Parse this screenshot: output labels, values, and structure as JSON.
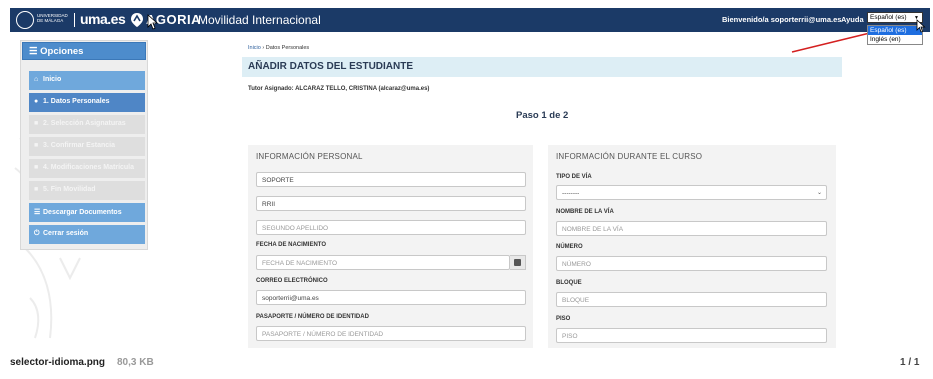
{
  "header": {
    "logo_uma_text": "UNIVERSIDAD\nDE MÁLAGA",
    "logo_umaes": "uma.es",
    "logo_agoria": "AGORIA",
    "app_title": "Movilidad Internacional",
    "welcome": "Bienvenido/a soporterrii@uma.es",
    "help": "Ayuda",
    "lang_selected": "Español (es)",
    "lang_options": [
      "Español (es)",
      "Inglés (en)"
    ],
    "colors": {
      "bar": "#1b3a67",
      "accent": "#4d8ccc",
      "annotation_arrow": "#d42020"
    }
  },
  "sidebar": {
    "title": "Opciones",
    "items": [
      {
        "label": "Inicio",
        "icon": "home-icon",
        "state": "enabled"
      },
      {
        "label": "1. Datos Personales",
        "icon": "user-icon",
        "state": "active"
      },
      {
        "label": "2. Selección Asignaturas",
        "icon": "list-icon",
        "state": "disabled"
      },
      {
        "label": "3. Confirmar Estancia",
        "icon": "list-icon",
        "state": "disabled"
      },
      {
        "label": "4. Modificaciones Matrícula",
        "icon": "list-icon",
        "state": "disabled"
      },
      {
        "label": "5. Fin Movilidad",
        "icon": "list-icon",
        "state": "disabled"
      },
      {
        "label": "Descargar Documentos",
        "icon": "list-icon",
        "state": "enabled"
      },
      {
        "label": "Cerrar sesión",
        "icon": "power-icon",
        "state": "enabled"
      }
    ]
  },
  "breadcrumb": {
    "home": "Inicio",
    "current": "Datos Personales"
  },
  "page": {
    "title": "AÑADIR DATOS DEL ESTUDIANTE",
    "tutor": "Tutor Asignado: ALCARAZ TELLO, CRISTINA (alcaraz@uma.es)",
    "step": "Paso 1 de 2"
  },
  "personal": {
    "title": "INFORMACIÓN PERSONAL",
    "name_value": "SOPORTE",
    "surname1_value": "RRII",
    "surname2_placeholder": "SEGUNDO APELLIDO",
    "birth_label": "FECHA DE NACIMIENTO",
    "birth_placeholder": "FECHA DE NACIMIENTO",
    "email_label": "CORREO ELECTRÓNICO",
    "email_value": "soporterrii@uma.es",
    "passport_label": "PASAPORTE / NÚMERO DE IDENTIDAD",
    "passport_placeholder": "PASAPORTE / NÚMERO DE IDENTIDAD"
  },
  "course": {
    "title": "INFORMACIÓN DURANTE EL CURSO",
    "road_type_label": "TIPO DE VÍA",
    "road_type_value": "--------",
    "road_name_label": "NOMBRE DE LA VÍA",
    "road_name_placeholder": "NOMBRE DE LA VÍA",
    "number_label": "NÚMERO",
    "number_placeholder": "NÚMERO",
    "block_label": "BLOQUE",
    "block_placeholder": "BLOQUE",
    "floor_label": "PISO",
    "floor_placeholder": "PISO"
  },
  "viewer": {
    "file_name": "selector-idioma.png",
    "file_size": "80,3 KB",
    "page_count": "1 / 1"
  }
}
